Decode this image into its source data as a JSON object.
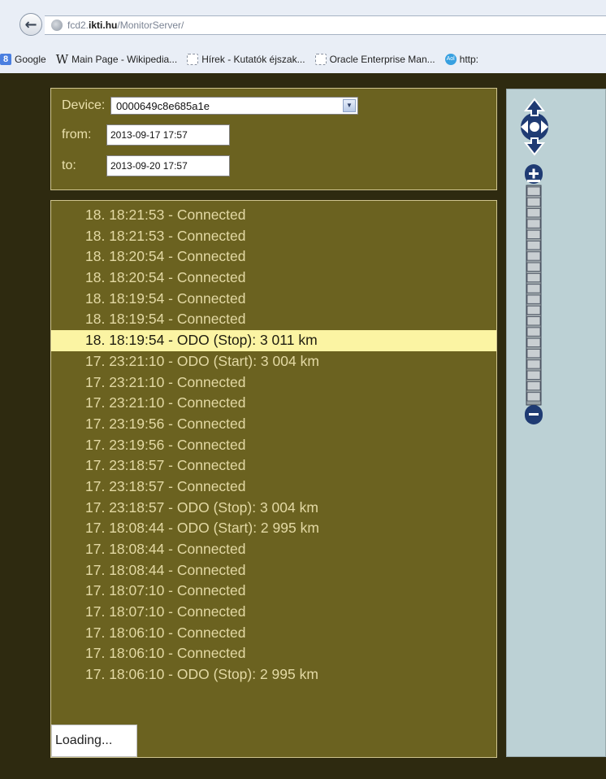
{
  "browser": {
    "url_prefix": "fcd2.",
    "url_domain": "ikti.hu",
    "url_path": "/MonitorServer/",
    "back_icon": "back-arrow-icon",
    "bookmarks": [
      {
        "icon": "google-icon",
        "label": "Google"
      },
      {
        "icon": "wikipedia-icon",
        "label": "Main Page - Wikipedia..."
      },
      {
        "icon": "page-icon",
        "label": "Hírek - Kutatók éjszak..."
      },
      {
        "icon": "page-icon",
        "label": "Oracle Enterprise Man..."
      },
      {
        "icon": "aol-icon",
        "label": "http:"
      }
    ]
  },
  "controls": {
    "device_label": "Device:",
    "device_value": "0000649c8e685a1e",
    "from_label": "from:",
    "from_value": "2013-09-17 17:57",
    "to_label": "to:",
    "to_value": "2013-09-20 17:57"
  },
  "log": {
    "entries": [
      "18. 18:21:53 - Connected",
      "18. 18:21:53 - Connected",
      "18. 18:20:54 - Connected",
      "18. 18:20:54 - Connected",
      "18. 18:19:54 - Connected",
      "18. 18:19:54 - Connected",
      "18. 18:19:54 - ODO (Stop): 3 011 km",
      "17. 23:21:10 - ODO (Start): 3 004 km",
      "17. 23:21:10 - Connected",
      "17. 23:21:10 - Connected",
      "17. 23:19:56 - Connected",
      "17. 23:19:56 - Connected",
      "17. 23:18:57 - Connected",
      "17. 23:18:57 - Connected",
      "17. 23:18:57 - ODO (Stop): 3 004 km",
      "17. 18:08:44 - ODO (Start): 2 995 km",
      "17. 18:08:44 - Connected",
      "17. 18:08:44 - Connected",
      "17. 18:07:10 - Connected",
      "17. 18:07:10 - Connected",
      "17. 18:06:10 - Connected",
      "17. 18:06:10 - Connected",
      "17. 18:06:10 - ODO (Stop): 2 995 km"
    ],
    "selected_index": 6,
    "loading_text": "Loading..."
  },
  "map": {
    "pan_icon": "pan-arrows-icon",
    "zoom_in_icon": "zoom-in-icon",
    "zoom_out_icon": "zoom-out-icon",
    "zoom_levels": 20,
    "colors": {
      "map_bg": "#bcd1d5",
      "control": "#1f3b73"
    }
  },
  "colors": {
    "panel_bg": "#6b6220",
    "page_bg": "#2e2a10",
    "text": "#e3d9a4",
    "selected_bg": "#fbf4a3"
  }
}
